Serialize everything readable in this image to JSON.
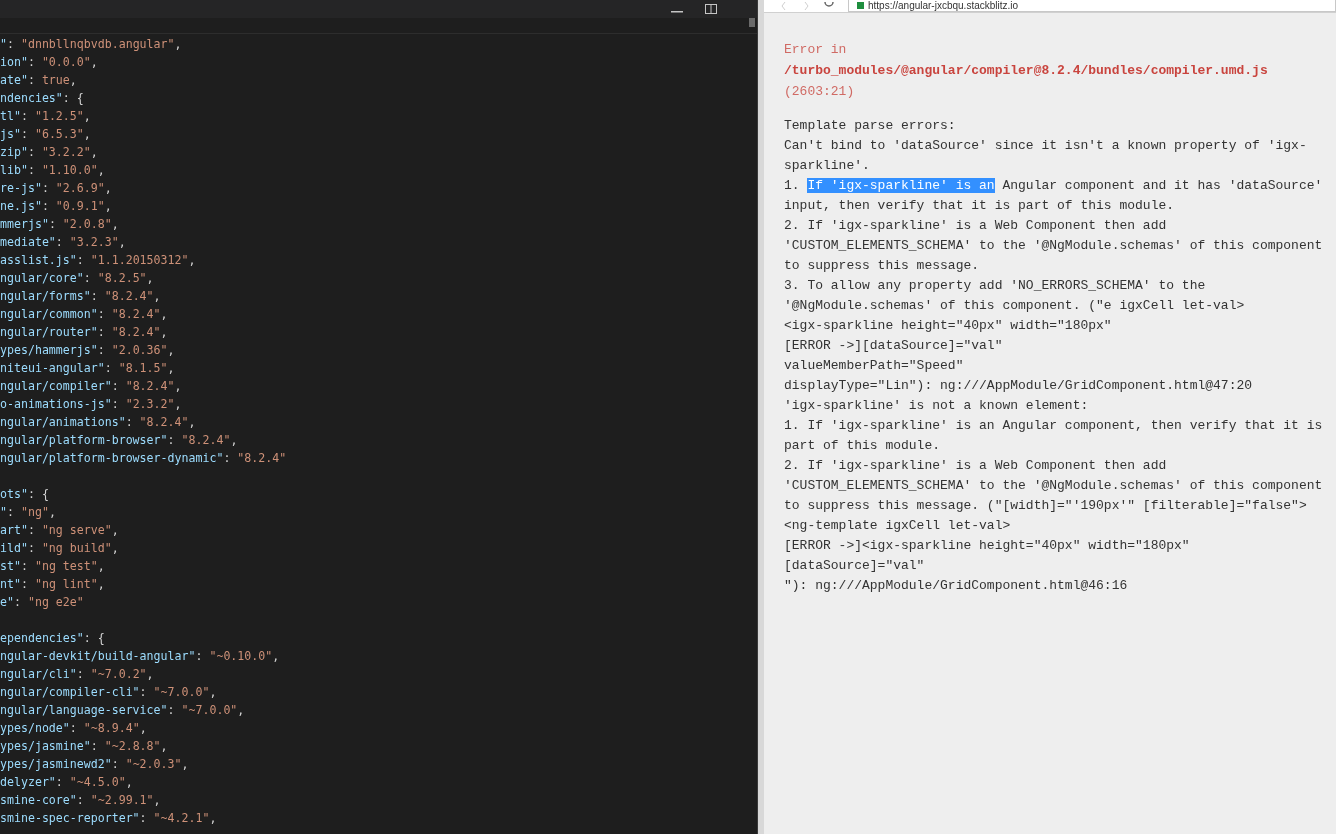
{
  "editor": {
    "blocks": [
      {
        "lines": [
          {
            "key": "\"",
            "sep": ": ",
            "value": "\"dnnbllnqbvdb.angular\"",
            "tail": ","
          },
          {
            "key": "ion\"",
            "sep": ": ",
            "value": "\"0.0.0\"",
            "tail": ","
          },
          {
            "key": "ate\"",
            "sep": ": ",
            "value": "true",
            "tail": ","
          },
          {
            "key": "ndencies\"",
            "sep": ": ",
            "brace": "{"
          },
          {
            "key": "tl\"",
            "sep": ": ",
            "value": "\"1.2.5\"",
            "tail": ","
          },
          {
            "key": "js\"",
            "sep": ": ",
            "value": "\"6.5.3\"",
            "tail": ","
          },
          {
            "key": "zip\"",
            "sep": ": ",
            "value": "\"3.2.2\"",
            "tail": ","
          },
          {
            "key": "lib\"",
            "sep": ": ",
            "value": "\"1.10.0\"",
            "tail": ","
          },
          {
            "key": "re-js\"",
            "sep": ": ",
            "value": "\"2.6.9\"",
            "tail": ","
          },
          {
            "key": "ne.js\"",
            "sep": ": ",
            "value": "\"0.9.1\"",
            "tail": ","
          },
          {
            "key": "mmerjs\"",
            "sep": ": ",
            "value": "\"2.0.8\"",
            "tail": ","
          },
          {
            "key": "mediate\"",
            "sep": ": ",
            "value": "\"3.2.3\"",
            "tail": ","
          },
          {
            "key": "asslist.js\"",
            "sep": ": ",
            "value": "\"1.1.20150312\"",
            "tail": ","
          },
          {
            "key": "ngular/core\"",
            "sep": ": ",
            "value": "\"8.2.5\"",
            "tail": ","
          },
          {
            "key": "ngular/forms\"",
            "sep": ": ",
            "value": "\"8.2.4\"",
            "tail": ","
          },
          {
            "key": "ngular/common\"",
            "sep": ": ",
            "value": "\"8.2.4\"",
            "tail": ","
          },
          {
            "key": "ngular/router\"",
            "sep": ": ",
            "value": "\"8.2.4\"",
            "tail": ","
          },
          {
            "key": "ypes/hammerjs\"",
            "sep": ": ",
            "value": "\"2.0.36\"",
            "tail": ","
          },
          {
            "key": "niteui-angular\"",
            "sep": ": ",
            "value": "\"8.1.5\"",
            "tail": ","
          },
          {
            "key": "ngular/compiler\"",
            "sep": ": ",
            "value": "\"8.2.4\"",
            "tail": ","
          },
          {
            "key": "o-animations-js\"",
            "sep": ": ",
            "value": "\"2.3.2\"",
            "tail": ","
          },
          {
            "key": "ngular/animations\"",
            "sep": ": ",
            "value": "\"8.2.4\"",
            "tail": ","
          },
          {
            "key": "ngular/platform-browser\"",
            "sep": ": ",
            "value": "\"8.2.4\"",
            "tail": ","
          },
          {
            "key": "ngular/platform-browser-dynamic\"",
            "sep": ": ",
            "value": "\"8.2.4\""
          }
        ]
      },
      {
        "lines": [
          {
            "key": "ots\"",
            "sep": ": ",
            "brace": "{"
          },
          {
            "key": "\"",
            "sep": ": ",
            "value": "\"ng\"",
            "tail": ","
          },
          {
            "key": "art\"",
            "sep": ": ",
            "value": "\"ng serve\"",
            "tail": ","
          },
          {
            "key": "ild\"",
            "sep": ": ",
            "value": "\"ng build\"",
            "tail": ","
          },
          {
            "key": "st\"",
            "sep": ": ",
            "value": "\"ng test\"",
            "tail": ","
          },
          {
            "key": "nt\"",
            "sep": ": ",
            "value": "\"ng lint\"",
            "tail": ","
          },
          {
            "key": "e\"",
            "sep": ": ",
            "value": "\"ng e2e\""
          }
        ]
      },
      {
        "lines": [
          {
            "key": "ependencies\"",
            "sep": ": ",
            "brace": "{"
          },
          {
            "key": "ngular-devkit/build-angular\"",
            "sep": ": ",
            "value": "\"~0.10.0\"",
            "tail": ","
          },
          {
            "key": "ngular/cli\"",
            "sep": ": ",
            "value": "\"~7.0.2\"",
            "tail": ","
          },
          {
            "key": "ngular/compiler-cli\"",
            "sep": ": ",
            "value": "\"~7.0.0\"",
            "tail": ","
          },
          {
            "key": "ngular/language-service\"",
            "sep": ": ",
            "value": "\"~7.0.0\"",
            "tail": ","
          },
          {
            "key": "ypes/node\"",
            "sep": ": ",
            "value": "\"~8.9.4\"",
            "tail": ","
          },
          {
            "key": "ypes/jasmine\"",
            "sep": ": ",
            "value": "\"~2.8.8\"",
            "tail": ","
          },
          {
            "key": "ypes/jasminewd2\"",
            "sep": ": ",
            "value": "\"~2.0.3\"",
            "tail": ","
          },
          {
            "key": "delyzer\"",
            "sep": ": ",
            "value": "\"~4.5.0\"",
            "tail": ","
          },
          {
            "key": "smine-core\"",
            "sep": ": ",
            "value": "\"~2.99.1\"",
            "tail": ","
          },
          {
            "key": "smine-spec-reporter\"",
            "sep": ": ",
            "value": "\"~4.2.1\"",
            "tail": ","
          }
        ]
      }
    ]
  },
  "browser": {
    "url": "https://angular-jxcbqu.stackblitz.io",
    "error_header": [
      {
        "text": "Error in",
        "kind": "label"
      },
      {
        "text": "/turbo_modules/@angular/compiler@8.2.4/bundles/compiler.umd.js",
        "kind": "path"
      },
      {
        "text": "(2603:21)",
        "kind": "label"
      }
    ],
    "message_lines": [
      {
        "text": "Template parse errors:"
      },
      {
        "text": "Can't bind to 'dataSource' since it isn't a known property of 'igx-"
      },
      {
        "text": "sparkline'."
      },
      {
        "text": "1. ",
        "selection": "If 'igx-sparkline' is an",
        "rest": " Angular component and it has 'dataSource'"
      },
      {
        "text": "input, then verify that it is part of this module."
      },
      {
        "text": "2. If 'igx-sparkline' is a Web Component then add"
      },
      {
        "text": "'CUSTOM_ELEMENTS_SCHEMA' to the '@NgModule.schemas' of this component"
      },
      {
        "text": "to suppress this message."
      },
      {
        "text": "3. To allow any property add 'NO_ERRORS_SCHEMA' to the"
      },
      {
        "text": "'@NgModule.schemas' of this component. (\"e igxCell let-val>"
      },
      {
        "text": "<igx-sparkline height=\"40px\" width=\"180px\""
      },
      {
        "text": "[ERROR ->][dataSource]=\"val\""
      },
      {
        "text": "valueMemberPath=\"Speed\""
      },
      {
        "text": "displayType=\"Lin\"): ng:///AppModule/GridComponent.html@47:20"
      },
      {
        "text": "'igx-sparkline' is not a known element:"
      },
      {
        "text": "1. If 'igx-sparkline' is an Angular component, then verify that it is"
      },
      {
        "text": "part of this module."
      },
      {
        "text": "2. If 'igx-sparkline' is a Web Component then add"
      },
      {
        "text": "'CUSTOM_ELEMENTS_SCHEMA' to the '@NgModule.schemas' of this component"
      },
      {
        "text": "to suppress this message. (\"[width]=\"'190px'\" [filterable]=\"false\">"
      },
      {
        "text": "<ng-template igxCell let-val>"
      },
      {
        "text": "[ERROR ->]<igx-sparkline height=\"40px\" width=\"180px\""
      },
      {
        "text": "[dataSource]=\"val\""
      },
      {
        "text": "\"): ng:///AppModule/GridComponent.html@46:16"
      }
    ]
  }
}
